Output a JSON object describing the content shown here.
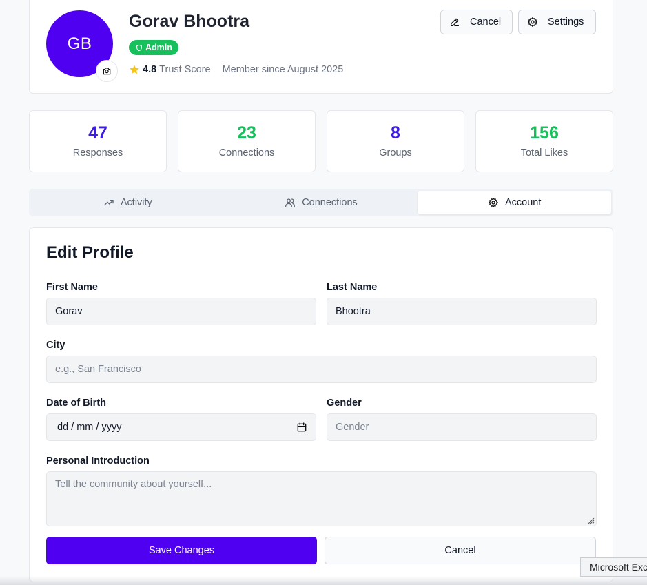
{
  "profile": {
    "initials": "GB",
    "name": "Gorav Bhootra",
    "badge": "Admin",
    "rating": "4.8",
    "rating_label": "Trust Score",
    "member_since": "Member since August 2025",
    "cancel_label": "Cancel",
    "settings_label": "Settings"
  },
  "stats": [
    {
      "value": "47",
      "label": "Responses",
      "color": "#3f1ce0"
    },
    {
      "value": "23",
      "label": "Connections",
      "color": "#16c15c"
    },
    {
      "value": "8",
      "label": "Groups",
      "color": "#3f1ce0"
    },
    {
      "value": "156",
      "label": "Total Likes",
      "color": "#16c15c"
    }
  ],
  "tabs": [
    {
      "label": "Activity",
      "icon": "trending-up-icon"
    },
    {
      "label": "Connections",
      "icon": "users-icon"
    },
    {
      "label": "Account",
      "icon": "gear-icon",
      "active": true
    }
  ],
  "form": {
    "title": "Edit Profile",
    "first_name_label": "First Name",
    "first_name_value": "Gorav",
    "last_name_label": "Last Name",
    "last_name_value": "Bhootra",
    "city_label": "City",
    "city_placeholder": "e.g., San Francisco",
    "dob_label": "Date of Birth",
    "dob_placeholder": "dd / mm / yyyy",
    "gender_label": "Gender",
    "gender_placeholder": "Gender",
    "intro_label": "Personal Introduction",
    "intro_placeholder": "Tell the community about yourself...",
    "save_label": "Save Changes",
    "cancel_label": "Cancel"
  },
  "tooltip": "Microsoft Exc",
  "colors": {
    "accent": "#4f00f0",
    "success": "#16c15c",
    "star": "#f5c518"
  }
}
